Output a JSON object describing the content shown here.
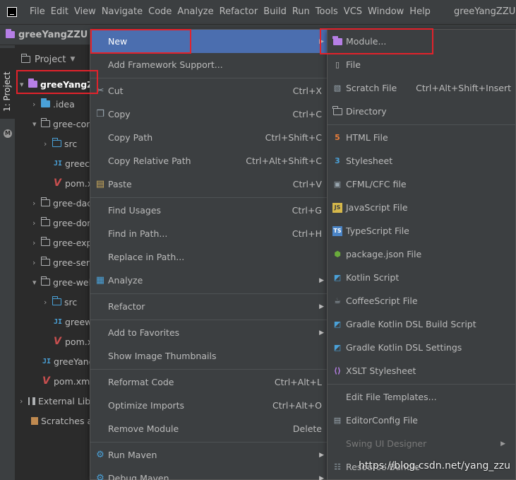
{
  "menubar": {
    "items": [
      "File",
      "Edit",
      "View",
      "Navigate",
      "Code",
      "Analyze",
      "Refactor",
      "Build",
      "Run",
      "Tools",
      "VCS",
      "Window",
      "Help"
    ],
    "window_title": "greeYangZZU ["
  },
  "navbar": {
    "project": "greeYangZZU",
    "separator": "❯"
  },
  "tool_stripe": {
    "label": "1: Project"
  },
  "project_panel": {
    "title": "Project",
    "tree": [
      {
        "label": "greeYangZ",
        "icon": "module-folder-icon",
        "arrow": "▾"
      },
      {
        "label": ".idea",
        "icon": "idea-folder-icon",
        "arrow": "›"
      },
      {
        "label": "gree-cor",
        "icon": "folder-icon",
        "arrow": "▾"
      },
      {
        "label": "src",
        "icon": "source-folder-icon",
        "arrow": "›"
      },
      {
        "label": "greec",
        "icon": "iml-file-icon",
        "arrow": ""
      },
      {
        "label": "pom.x",
        "icon": "maven-file-icon",
        "arrow": ""
      },
      {
        "label": "gree-dac",
        "icon": "folder-icon",
        "arrow": "›"
      },
      {
        "label": "gree-dor",
        "icon": "folder-icon",
        "arrow": "›"
      },
      {
        "label": "gree-exp",
        "icon": "folder-icon",
        "arrow": "›"
      },
      {
        "label": "gree-ser",
        "icon": "folder-icon",
        "arrow": "›"
      },
      {
        "label": "gree-wel",
        "icon": "folder-icon",
        "arrow": "▾"
      },
      {
        "label": "src",
        "icon": "source-folder-icon",
        "arrow": "›"
      },
      {
        "label": "greew",
        "icon": "iml-file-icon",
        "arrow": ""
      },
      {
        "label": "pom.x",
        "icon": "maven-file-icon",
        "arrow": ""
      },
      {
        "label": "greeYang",
        "icon": "iml-file-icon",
        "arrow": ""
      },
      {
        "label": "pom.xml",
        "icon": "maven-file-icon",
        "arrow": ""
      },
      {
        "label": "External Lib",
        "icon": "library-icon",
        "arrow": "›"
      },
      {
        "label": "Scratches a",
        "icon": "scratches-icon",
        "arrow": ""
      }
    ]
  },
  "context_menu": {
    "items": [
      {
        "label": "New",
        "shortcut": "",
        "submenu": true,
        "icon": ""
      },
      {
        "label": "Add Framework Support...",
        "shortcut": "",
        "submenu": false,
        "icon": ""
      },
      {
        "label": "Cut",
        "shortcut": "Ctrl+X",
        "submenu": false,
        "icon": "cut-icon"
      },
      {
        "label": "Copy",
        "shortcut": "Ctrl+C",
        "submenu": false,
        "icon": "copy-icon"
      },
      {
        "label": "Copy Path",
        "shortcut": "Ctrl+Shift+C",
        "submenu": false,
        "icon": ""
      },
      {
        "label": "Copy Relative Path",
        "shortcut": "Ctrl+Alt+Shift+C",
        "submenu": false,
        "icon": ""
      },
      {
        "label": "Paste",
        "shortcut": "Ctrl+V",
        "submenu": false,
        "icon": "paste-icon"
      },
      {
        "label": "Find Usages",
        "shortcut": "Ctrl+G",
        "submenu": false,
        "icon": ""
      },
      {
        "label": "Find in Path...",
        "shortcut": "Ctrl+H",
        "submenu": false,
        "icon": ""
      },
      {
        "label": "Replace in Path...",
        "shortcut": "",
        "submenu": false,
        "icon": ""
      },
      {
        "label": "Analyze",
        "shortcut": "",
        "submenu": true,
        "icon": "analyze-icon"
      },
      {
        "label": "Refactor",
        "shortcut": "",
        "submenu": true,
        "icon": ""
      },
      {
        "label": "Add to Favorites",
        "shortcut": "",
        "submenu": true,
        "icon": ""
      },
      {
        "label": "Show Image Thumbnails",
        "shortcut": "",
        "submenu": false,
        "icon": ""
      },
      {
        "label": "Reformat Code",
        "shortcut": "Ctrl+Alt+L",
        "submenu": false,
        "icon": ""
      },
      {
        "label": "Optimize Imports",
        "shortcut": "Ctrl+Alt+O",
        "submenu": false,
        "icon": ""
      },
      {
        "label": "Remove Module",
        "shortcut": "Delete",
        "submenu": false,
        "icon": ""
      },
      {
        "label": "Run Maven",
        "shortcut": "",
        "submenu": true,
        "icon": "maven-gear-icon"
      },
      {
        "label": "Debug Maven",
        "shortcut": "",
        "submenu": true,
        "icon": "maven-gear-icon"
      }
    ]
  },
  "new_submenu": {
    "items": [
      {
        "label": "Module...",
        "shortcut": "",
        "icon": "module-folder-icon",
        "disabled": false,
        "submenu": false
      },
      {
        "label": "File",
        "shortcut": "",
        "icon": "file-icon",
        "disabled": false,
        "submenu": false
      },
      {
        "label": "Scratch File",
        "shortcut": "Ctrl+Alt+Shift+Insert",
        "icon": "scratch-file-icon",
        "disabled": false,
        "submenu": false
      },
      {
        "label": "Directory",
        "shortcut": "",
        "icon": "folder-icon",
        "disabled": false,
        "submenu": false
      },
      {
        "label": "HTML File",
        "shortcut": "",
        "icon": "html5-icon",
        "disabled": false,
        "submenu": false
      },
      {
        "label": "Stylesheet",
        "shortcut": "",
        "icon": "css-icon",
        "disabled": false,
        "submenu": false
      },
      {
        "label": "CFML/CFC file",
        "shortcut": "",
        "icon": "cfml-icon",
        "disabled": false,
        "submenu": false
      },
      {
        "label": "JavaScript File",
        "shortcut": "",
        "icon": "javascript-icon",
        "disabled": false,
        "submenu": false
      },
      {
        "label": "TypeScript File",
        "shortcut": "",
        "icon": "typescript-icon",
        "disabled": false,
        "submenu": false
      },
      {
        "label": "package.json File",
        "shortcut": "",
        "icon": "nodejs-icon",
        "disabled": false,
        "submenu": false
      },
      {
        "label": "Kotlin Script",
        "shortcut": "",
        "icon": "kotlin-icon",
        "disabled": false,
        "submenu": false
      },
      {
        "label": "CoffeeScript File",
        "shortcut": "",
        "icon": "coffeescript-icon",
        "disabled": false,
        "submenu": false
      },
      {
        "label": "Gradle Kotlin DSL Build Script",
        "shortcut": "",
        "icon": "gradle-kotlin-icon",
        "disabled": false,
        "submenu": false
      },
      {
        "label": "Gradle Kotlin DSL Settings",
        "shortcut": "",
        "icon": "gradle-kotlin-icon",
        "disabled": false,
        "submenu": false
      },
      {
        "label": "XSLT Stylesheet",
        "shortcut": "",
        "icon": "xslt-icon",
        "disabled": false,
        "submenu": false
      },
      {
        "label": "Edit File Templates...",
        "shortcut": "",
        "icon": "",
        "disabled": false,
        "submenu": false
      },
      {
        "label": "EditorConfig File",
        "shortcut": "",
        "icon": "editorconfig-icon",
        "disabled": false,
        "submenu": false
      },
      {
        "label": "Swing UI Designer",
        "shortcut": "",
        "icon": "",
        "disabled": true,
        "submenu": true
      },
      {
        "label": "Resource Bundle",
        "shortcut": "",
        "icon": "resource-bundle-icon",
        "disabled": false,
        "submenu": false
      }
    ]
  },
  "watermark": "https://blog.csdn.net/yang_zzu",
  "colors": {
    "selected": "#4b6eaf",
    "annotation": "#e2222b",
    "menu_bg": "#3c3f41",
    "panel_bg": "#2b2b2b"
  }
}
